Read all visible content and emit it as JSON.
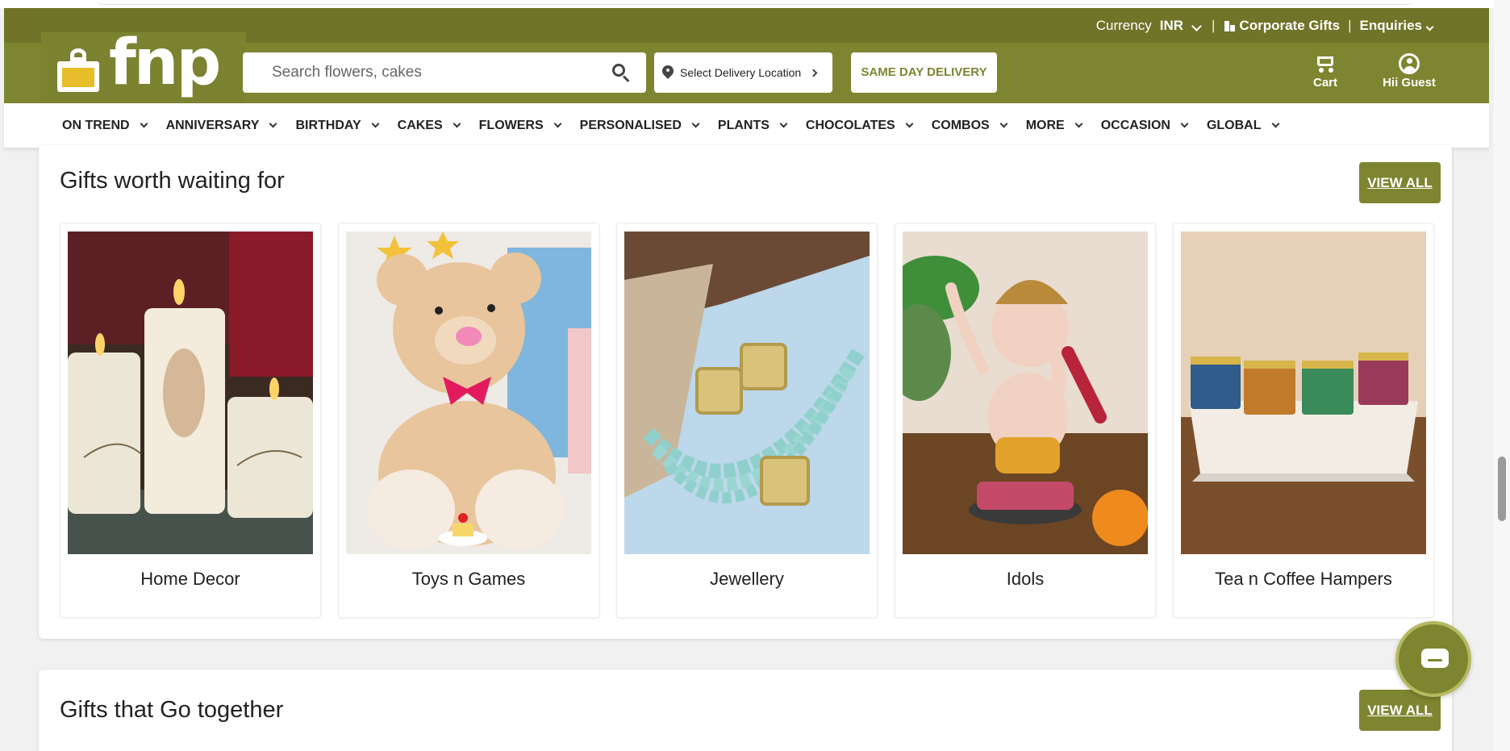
{
  "header": {
    "currency_label": "Currency",
    "currency_value": "INR",
    "separator": "|",
    "corporate_gifts": "Corporate Gifts",
    "enquiries": "Enquiries",
    "logo_text": "fnp",
    "search_placeholder": "Search flowers, cakes",
    "delivery_location": "Select Delivery Location",
    "same_day_delivery": "SAME DAY DELIVERY",
    "cart_label": "Cart",
    "user_label": "Hii Guest"
  },
  "nav": {
    "items": [
      "ON TREND",
      "ANNIVERSARY",
      "BIRTHDAY",
      "CAKES",
      "FLOWERS",
      "PERSONALISED",
      "PLANTS",
      "CHOCOLATES",
      "COMBOS",
      "MORE",
      "OCCASION",
      "GLOBAL"
    ]
  },
  "sections": [
    {
      "title": "Gifts worth waiting for",
      "view_all": "VIEW ALL",
      "cards": [
        "Home Decor",
        "Toys n Games",
        "Jewellery",
        "Idols",
        "Tea n Coffee Hampers"
      ]
    },
    {
      "title": "Gifts that Go together",
      "view_all": "VIEW ALL"
    }
  ],
  "colors": {
    "brand": "#7e8530",
    "brand_dark": "#6f7428",
    "logo_yellow": "#e7bd2a"
  },
  "icons": [
    "gift-logo-icon",
    "search-icon",
    "location-pin-icon",
    "chevron-right-icon",
    "cart-icon",
    "user-icon",
    "chevron-down-icon",
    "building-icon",
    "chat-icon"
  ]
}
